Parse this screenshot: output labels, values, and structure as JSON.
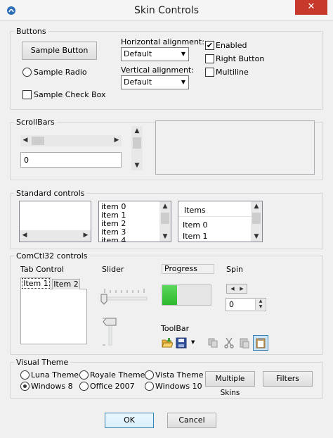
{
  "window": {
    "title": "Skin Controls",
    "close_glyph": "✕"
  },
  "buttons_group": {
    "title": "Buttons",
    "sample_button": "Sample Button",
    "sample_radio": "Sample Radio",
    "sample_check": "Sample Check Box",
    "horizontal_label": "Horizontal alignment:",
    "horizontal_value": "Default",
    "vertical_label": "Vertical alignment:",
    "vertical_value": "Default",
    "enabled_label": "Enabled",
    "enabled_checked": true,
    "right_button_label": "Right Button",
    "multiline_label": "Multiline"
  },
  "scrollbars_group": {
    "title": "ScrollBars",
    "position_value": "0"
  },
  "standard_group": {
    "title": "Standard controls",
    "list_items": [
      "item 0",
      "item 1",
      "item 2",
      "item 3",
      "item 4"
    ],
    "listview_header": "Items",
    "listview_items": [
      "Item 0",
      "Item 1"
    ]
  },
  "comctl_group": {
    "title": "ComCtl32 controls",
    "tab_control_label": "Tab Control",
    "tabs": [
      "Item 1",
      "Item 2"
    ],
    "slider_label": "Slider",
    "progress_label": "Progress",
    "progress_value": 0.3,
    "spin_label": "Spin",
    "spin_value": "0",
    "toolbar_label": "ToolBar"
  },
  "theme_group": {
    "title": "Visual Theme",
    "options": [
      "Luna Theme",
      "Royale Theme",
      "Vista Theme",
      "Windows 8",
      "Office 2007",
      "Windows 10"
    ],
    "selected": "Windows 8",
    "multiple_skins": "Multiple Skins",
    "filters": "Filters"
  },
  "footer": {
    "ok": "OK",
    "cancel": "Cancel"
  },
  "colors": {
    "close": "#c7392b",
    "progress": "#3cc13c",
    "accent": "#3c7fb1"
  }
}
